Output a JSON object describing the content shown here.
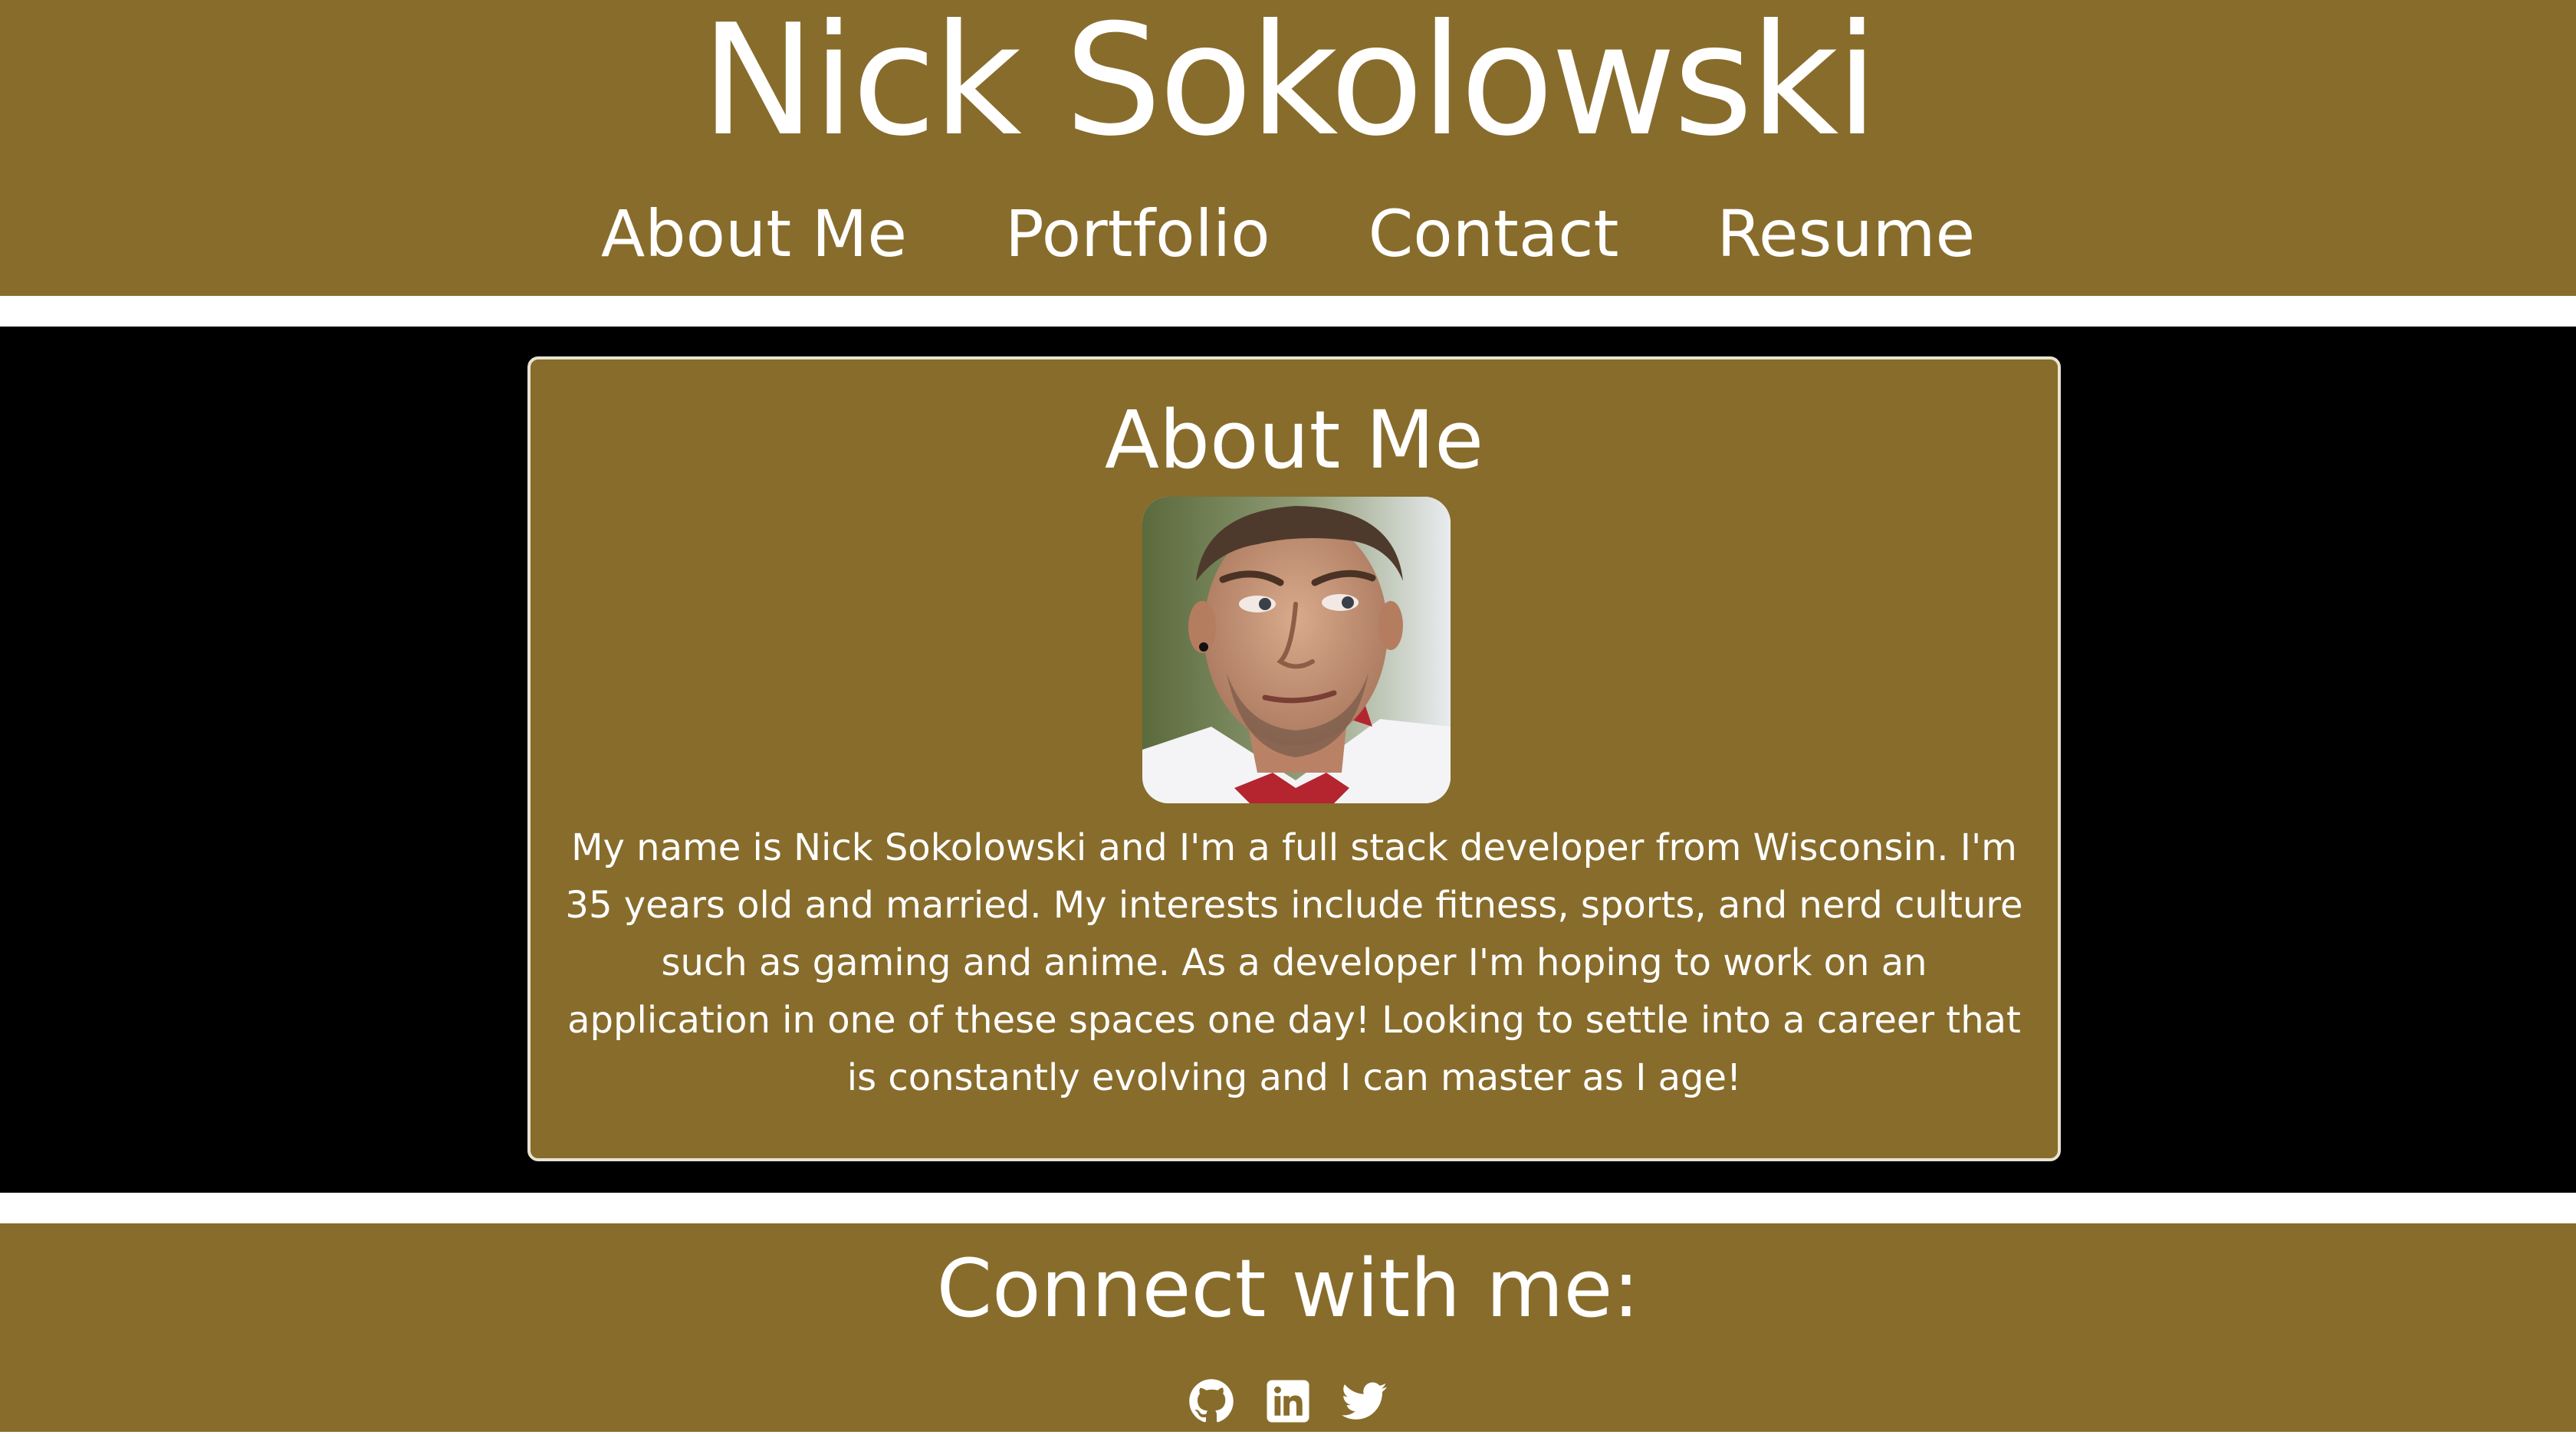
{
  "header": {
    "site_title": "Nick Sokolowski",
    "nav": [
      {
        "label": "About Me"
      },
      {
        "label": "Portfolio"
      },
      {
        "label": "Contact"
      },
      {
        "label": "Resume"
      }
    ]
  },
  "about": {
    "heading": "About Me",
    "bio": "My name is Nick Sokolowski and I'm a full stack developer from Wisconsin. I'm 35 years old and married. My interests include fitness, sports, and nerd culture such as gaming and anime. As a developer I'm hoping to work on an application in one of these spaces one day! Looking to settle into a career that is constantly evolving and I can master as I age!",
    "photo_alt": "Nick Sokolowski"
  },
  "footer": {
    "heading": "Connect with me:",
    "social": [
      {
        "icon": "github-icon"
      },
      {
        "icon": "linkedin-icon"
      },
      {
        "icon": "twitter-icon"
      }
    ]
  },
  "colors": {
    "brand_gold": "#886c2b",
    "main_background": "#000000",
    "text": "#ffffff"
  }
}
